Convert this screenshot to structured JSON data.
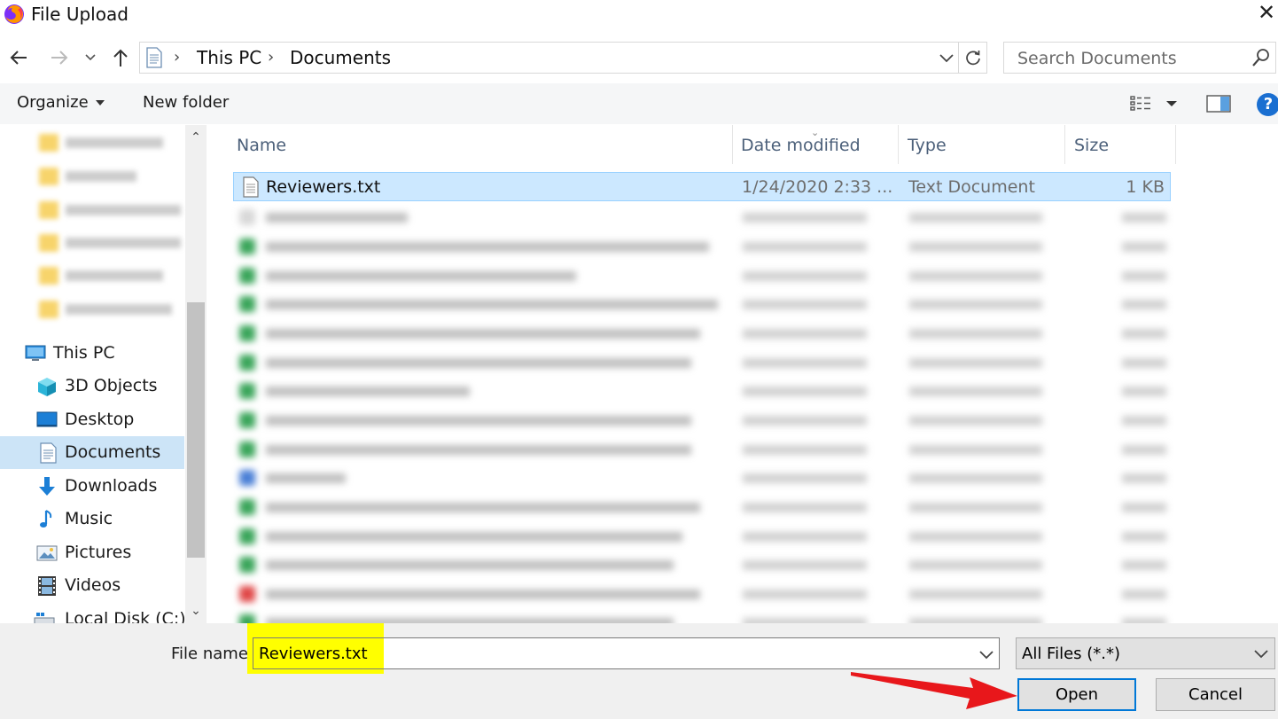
{
  "window": {
    "title": "File Upload",
    "close_glyph": "✕",
    "app_icon": "firefox-icon"
  },
  "navigation": {
    "back_icon": "back-arrow-icon",
    "forward_icon": "forward-arrow-icon",
    "recent_icon": "chevron-down-icon",
    "up_icon": "up-arrow-icon",
    "address": {
      "breadcrumbs": [
        "This PC",
        "Documents"
      ],
      "separator": "›"
    },
    "refresh_icon": "refresh-icon",
    "search": {
      "placeholder": "Search Documents"
    }
  },
  "toolbar": {
    "organize_label": "Organize",
    "new_folder_label": "New folder",
    "help_glyph": "?"
  },
  "nav_pane": {
    "items": [
      {
        "label": "This PC",
        "icon": "computer-icon",
        "selected": false
      },
      {
        "label": "3D Objects",
        "icon": "cube-icon",
        "selected": false
      },
      {
        "label": "Desktop",
        "icon": "desktop-icon",
        "selected": false
      },
      {
        "label": "Documents",
        "icon": "document-icon",
        "selected": true
      },
      {
        "label": "Downloads",
        "icon": "download-icon",
        "selected": false
      },
      {
        "label": "Music",
        "icon": "music-icon",
        "selected": false
      },
      {
        "label": "Pictures",
        "icon": "picture-icon",
        "selected": false
      },
      {
        "label": "Videos",
        "icon": "video-icon",
        "selected": false
      },
      {
        "label": "Local Disk (C:)",
        "icon": "drive-icon",
        "selected": false
      }
    ]
  },
  "file_list": {
    "columns": [
      "Name",
      "Date modified",
      "Type",
      "Size"
    ],
    "selected_file": {
      "name": "Reviewers.txt",
      "date_modified": "1/24/2020 2:33 ...",
      "type": "Text Document",
      "size": "1 KB"
    },
    "colors": {
      "selection_bg": "#cce8ff",
      "selection_border": "#99d1ff"
    }
  },
  "bottom": {
    "file_name_label": "File name:",
    "file_name_value": "Reviewers.txt",
    "file_type_value": "All Files (*.*)",
    "open_label": "Open",
    "cancel_label": "Cancel",
    "colors": {
      "highlight": "#ffff00",
      "arrow": "#e8171b",
      "open_border": "#0078d7"
    }
  }
}
